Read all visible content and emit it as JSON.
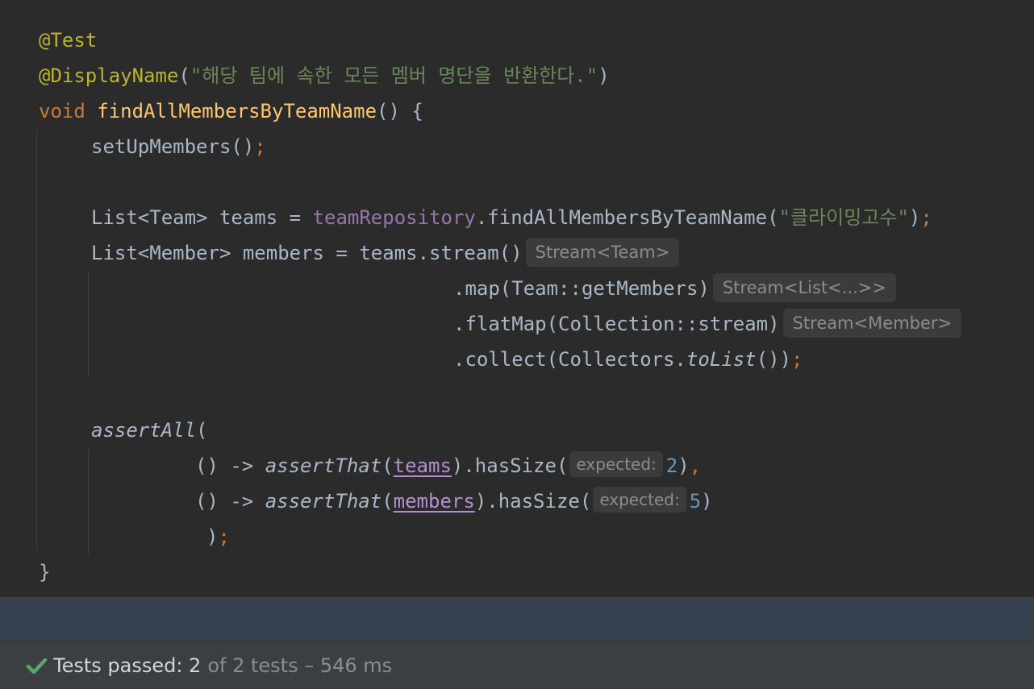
{
  "editor": {
    "lines": {
      "l1": {
        "annotation": "@Test"
      },
      "l2": {
        "annotation": "@DisplayName",
        "open": "(",
        "string": "\"해당 팀에 속한 모든 멤버 명단을 반환한다.\"",
        "close": ")"
      },
      "l3": {
        "keyword": "void",
        "method": "findAllMembersByTeamName",
        "rest": "() {"
      },
      "l4": {
        "code": "setUpMembers()",
        "semi": ";"
      },
      "l6": {
        "decl": "List<Team> teams = ",
        "field": "teamRepository",
        "call": ".findAllMembersByTeamName(",
        "string": "\"클라이밍고수\"",
        "close": ")",
        "semi": ";"
      },
      "l7": {
        "code": "List<Member> members = teams.stream()",
        "hint": "Stream<Team>"
      },
      "l8": {
        "code": ".map(Team::getMembers)",
        "hint": "Stream<List<...>>"
      },
      "l9": {
        "code": ".flatMap(Collection::stream)",
        "hint": "Stream<Member>"
      },
      "l10": {
        "code1": ".collect(Collectors.",
        "ital": "toList",
        "code2": "())",
        "semi": ";"
      },
      "l12": {
        "ital": "assertAll",
        "code": "("
      },
      "l13": {
        "arrow": "() -> ",
        "ital": "assertThat",
        "open": "(",
        "var": "teams",
        "call": ").hasSize(",
        "hint": "expected:",
        "num": "2",
        "close": ")",
        "comma": ","
      },
      "l14": {
        "arrow": "() -> ",
        "ital": "assertThat",
        "open": "(",
        "var": "members",
        "call": ").hasSize(",
        "hint": "expected:",
        "num": "5",
        "close": ")"
      },
      "l15": {
        "code": ")",
        "semi": ";"
      },
      "l16": {
        "code": "}"
      }
    }
  },
  "status": {
    "icon": "check-icon",
    "main": "Tests passed: 2",
    "sub": "of 2 tests – 546 ms",
    "check_color": "#59a869"
  }
}
